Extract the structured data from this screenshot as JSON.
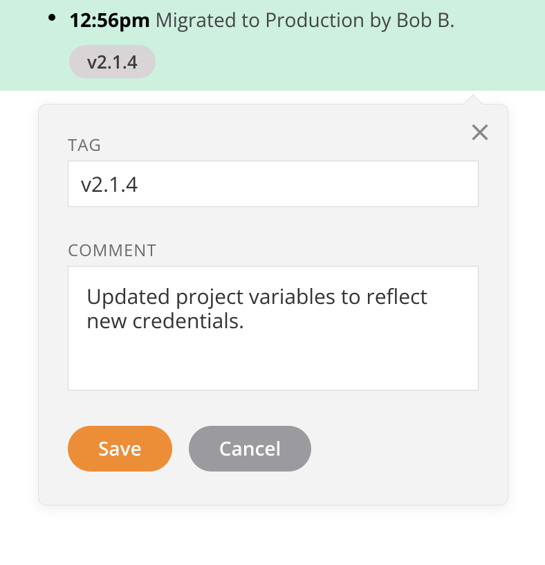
{
  "history": {
    "time": "12:56pm",
    "action": "Migrated to Production by Bob B.",
    "tag": "v2.1.4"
  },
  "form": {
    "tag_label": "TAG",
    "tag_value": "v2.1.4",
    "comment_label": "COMMENT",
    "comment_value": "Updated project variables to reflect new credentials."
  },
  "buttons": {
    "save": "Save",
    "cancel": "Cancel"
  }
}
